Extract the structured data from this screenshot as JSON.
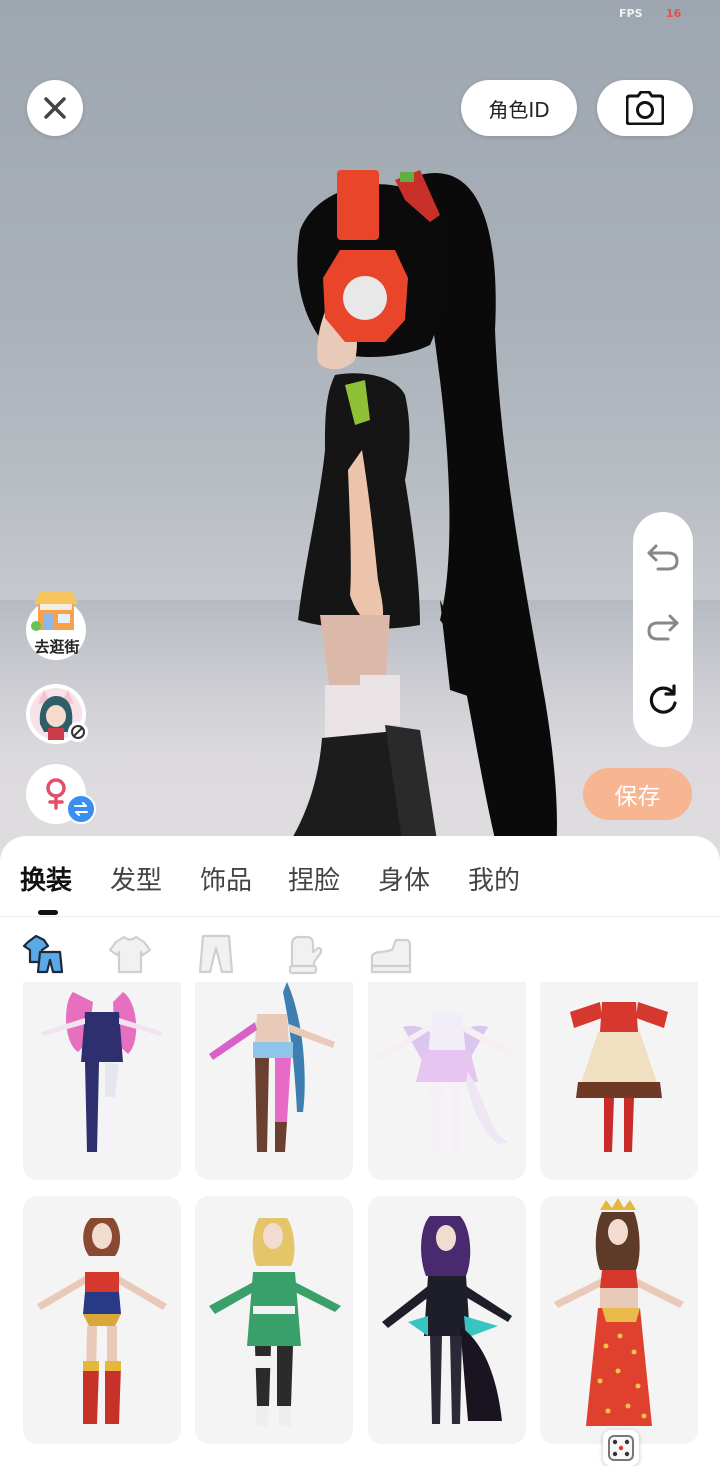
{
  "status": {
    "fps_label": "FPS",
    "fps_value": "16"
  },
  "header": {
    "role_id_label": "角色ID"
  },
  "left_actions": {
    "shop_label": "去逛街"
  },
  "toolbar": {
    "save_label": "保存"
  },
  "tabs": [
    {
      "label": "换装",
      "active": true
    },
    {
      "label": "发型",
      "active": false
    },
    {
      "label": "饰品",
      "active": false
    },
    {
      "label": "捏脸",
      "active": false
    },
    {
      "label": "身体",
      "active": false
    },
    {
      "label": "我的",
      "active": false
    }
  ],
  "sub_categories": [
    "outfit-set-icon",
    "top-icon",
    "pants-icon",
    "gloves-icon",
    "shoes-icon"
  ],
  "colors": {
    "accent_save": "#f7b591",
    "female_icon": "#e0506a",
    "switch_badge": "#3a8ef0"
  },
  "outfits": [
    {
      "name": "outfit-pink-magic"
    },
    {
      "name": "outfit-denim-shorts"
    },
    {
      "name": "outfit-white-fairy"
    },
    {
      "name": "outfit-red-ruffle-dress"
    },
    {
      "name": "outfit-red-gold-heroine"
    },
    {
      "name": "outfit-green-ninja"
    },
    {
      "name": "outfit-dark-gothic"
    },
    {
      "name": "outfit-red-dot-gown"
    }
  ]
}
